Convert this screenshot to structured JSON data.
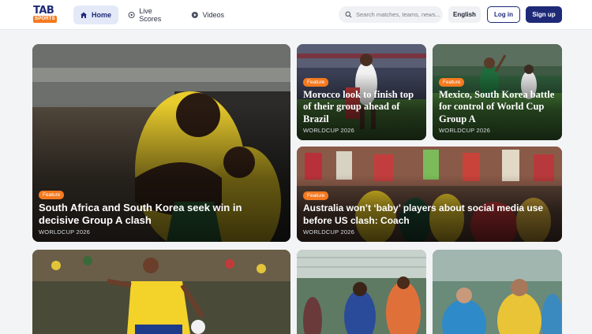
{
  "logo": {
    "line1": "TAB",
    "line2": "SPORTS"
  },
  "nav": [
    {
      "label": "Home",
      "icon": "home-icon",
      "active": true
    },
    {
      "label": "Live Scores",
      "icon": "live-scores-icon"
    },
    {
      "label": "Videos",
      "icon": "play-icon"
    }
  ],
  "search": {
    "placeholder": "Search matches, teams, news..."
  },
  "language": "English",
  "auth": {
    "login": "Log in",
    "signup": "Sign up"
  },
  "colors": {
    "brand_navy": "#1e2a78",
    "accent_orange": "#f47a20"
  },
  "cards": [
    {
      "badge": "Feature",
      "title": "South Africa and South Korea seek win in decisive Group A clash",
      "category": "WORLDCUP 2026"
    },
    {
      "badge": "Feature",
      "title": "Morocco look to finish top of their group ahead of Brazil",
      "category": "WORLDCUP 2026"
    },
    {
      "badge": "Feature",
      "title": "Mexico, South Korea battle for control of World Cup Group A",
      "category": "WORLDCUP 2026"
    },
    {
      "badge": "Feature",
      "title": "Australia won’t ‘baby’ players about social media use before US clash: Coach",
      "category": "WORLDCUP 2026"
    },
    {
      "badge": "",
      "title": "",
      "category": ""
    },
    {
      "badge": "",
      "title": "",
      "category": ""
    },
    {
      "badge": "",
      "title": "",
      "category": ""
    }
  ]
}
